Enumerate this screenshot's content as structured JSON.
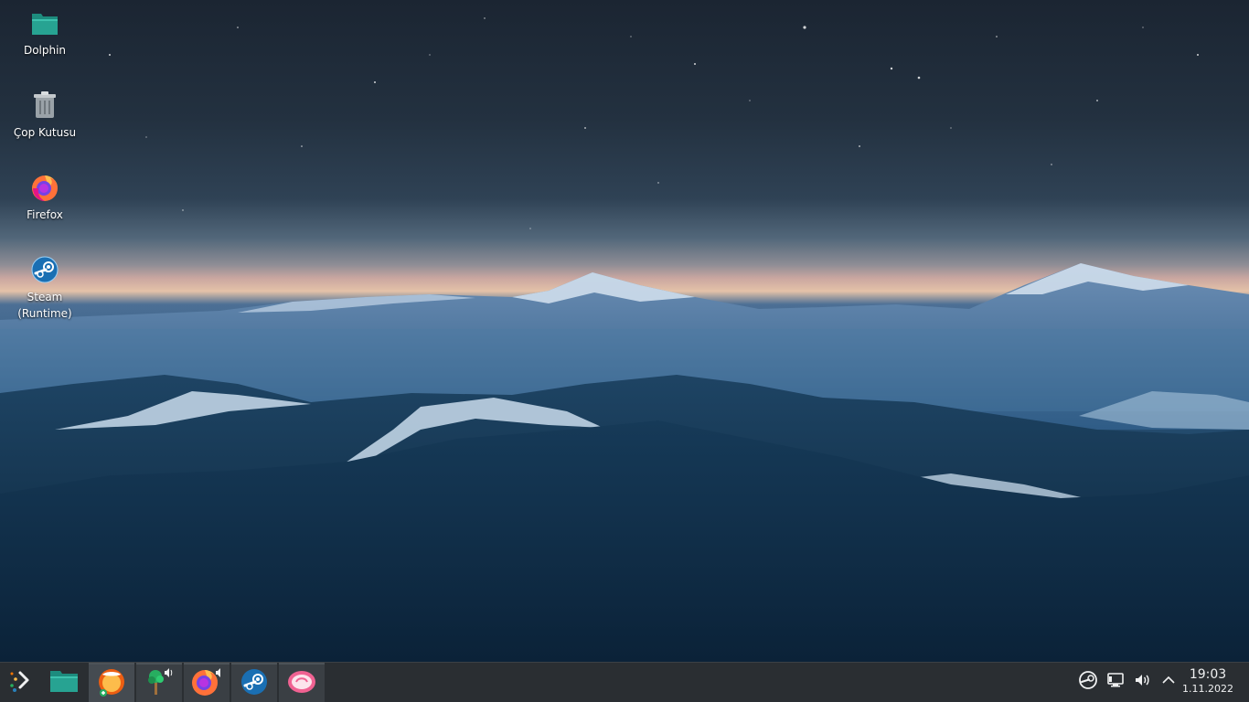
{
  "desktop": {
    "icons": [
      {
        "label": "Dolphin",
        "icon": "folder-icon"
      },
      {
        "label": "Çop Kutusu",
        "icon": "trash-icon"
      },
      {
        "label": "Firefox",
        "icon": "firefox-icon"
      },
      {
        "label": "Steam (Runtime)",
        "icon": "steam-icon"
      }
    ]
  },
  "taskbar": {
    "launcher_icon": "plasma-launcher-icon",
    "tasks": [
      {
        "icon": "dolphin-folder-icon"
      },
      {
        "icon": "discover-store-icon"
      },
      {
        "icon": "ktorrent-tree-icon",
        "audio": true
      },
      {
        "icon": "firefox-icon",
        "audio": true
      },
      {
        "icon": "steam-icon"
      },
      {
        "icon": "pink-app-icon"
      }
    ],
    "tray": [
      {
        "icon": "steam-tray-icon"
      },
      {
        "icon": "network-icon"
      },
      {
        "icon": "volume-icon"
      },
      {
        "icon": "expand-tray-icon"
      }
    ],
    "clock": {
      "time": "19:03",
      "date": "1.11.2022"
    }
  },
  "colors": {
    "panel": "#2a2e32",
    "task_bg": "#3a3f44",
    "text": "#eff0f1"
  }
}
